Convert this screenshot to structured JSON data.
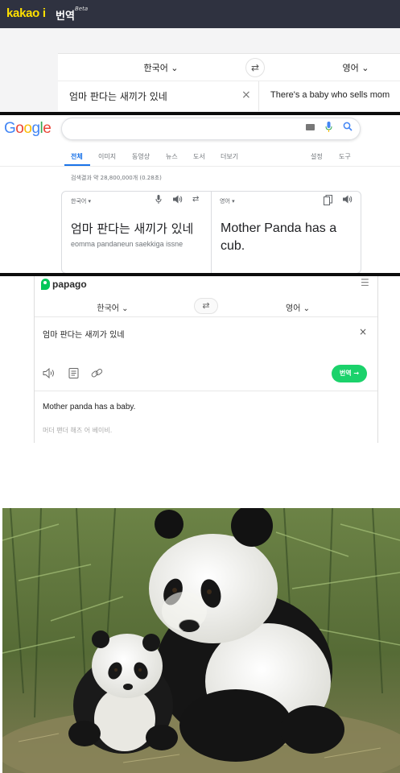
{
  "kakao": {
    "logo": "kakao i",
    "logo_sub": "번역",
    "beta": "Beta",
    "source_lang": "한국어 ⌄",
    "target_lang": "영어 ⌄",
    "swap": "⇄",
    "input_text": "엄마 판다는 새끼가 있네",
    "clear": "×",
    "output_text": "There's a baby who sells mom"
  },
  "google": {
    "logo_letters": [
      "G",
      "o",
      "o",
      "g",
      "l",
      "e"
    ],
    "logo_colors": [
      "#4285f4",
      "#ea4335",
      "#fbbc05",
      "#4285f4",
      "#34a853",
      "#ea4335"
    ],
    "tabs": [
      "전체",
      "이미지",
      "동영상",
      "뉴스",
      "도서",
      "더보기"
    ],
    "right_tabs": [
      "설정",
      "도구"
    ],
    "results_text": "검색결과 약 28,800,000개 (0.28초)",
    "source_lang": "한국어 ▾",
    "target_lang": "영어 ▾",
    "source_text": "엄마 판다는 새끼가 있네",
    "transliteration": "eomma pandaneun saekkiga issne",
    "target_text": "Mother Panda has a cub.",
    "icons": {
      "mic": "🎤",
      "speaker": "🔊",
      "swap": "⇄",
      "copy": "⧉"
    }
  },
  "papago": {
    "logo": "papago",
    "menu": "☰",
    "source_lang": "한국어 ⌄",
    "target_lang": "영어 ⌄",
    "swap": "⇄",
    "input_text": "엄마 판다는 새끼가 있네",
    "clear": "×",
    "translate_button": "번역 →",
    "output_text": "Mother panda has a baby.",
    "pronunciation": "머더 팬더 해즈 어 베이비."
  },
  "photo": {
    "subject": "panda-mother-and-cub",
    "colors": {
      "fur_white": "#f2f2ee",
      "fur_black": "#141414",
      "bamboo": "#5f7a3c",
      "ground": "#8a8459"
    }
  }
}
